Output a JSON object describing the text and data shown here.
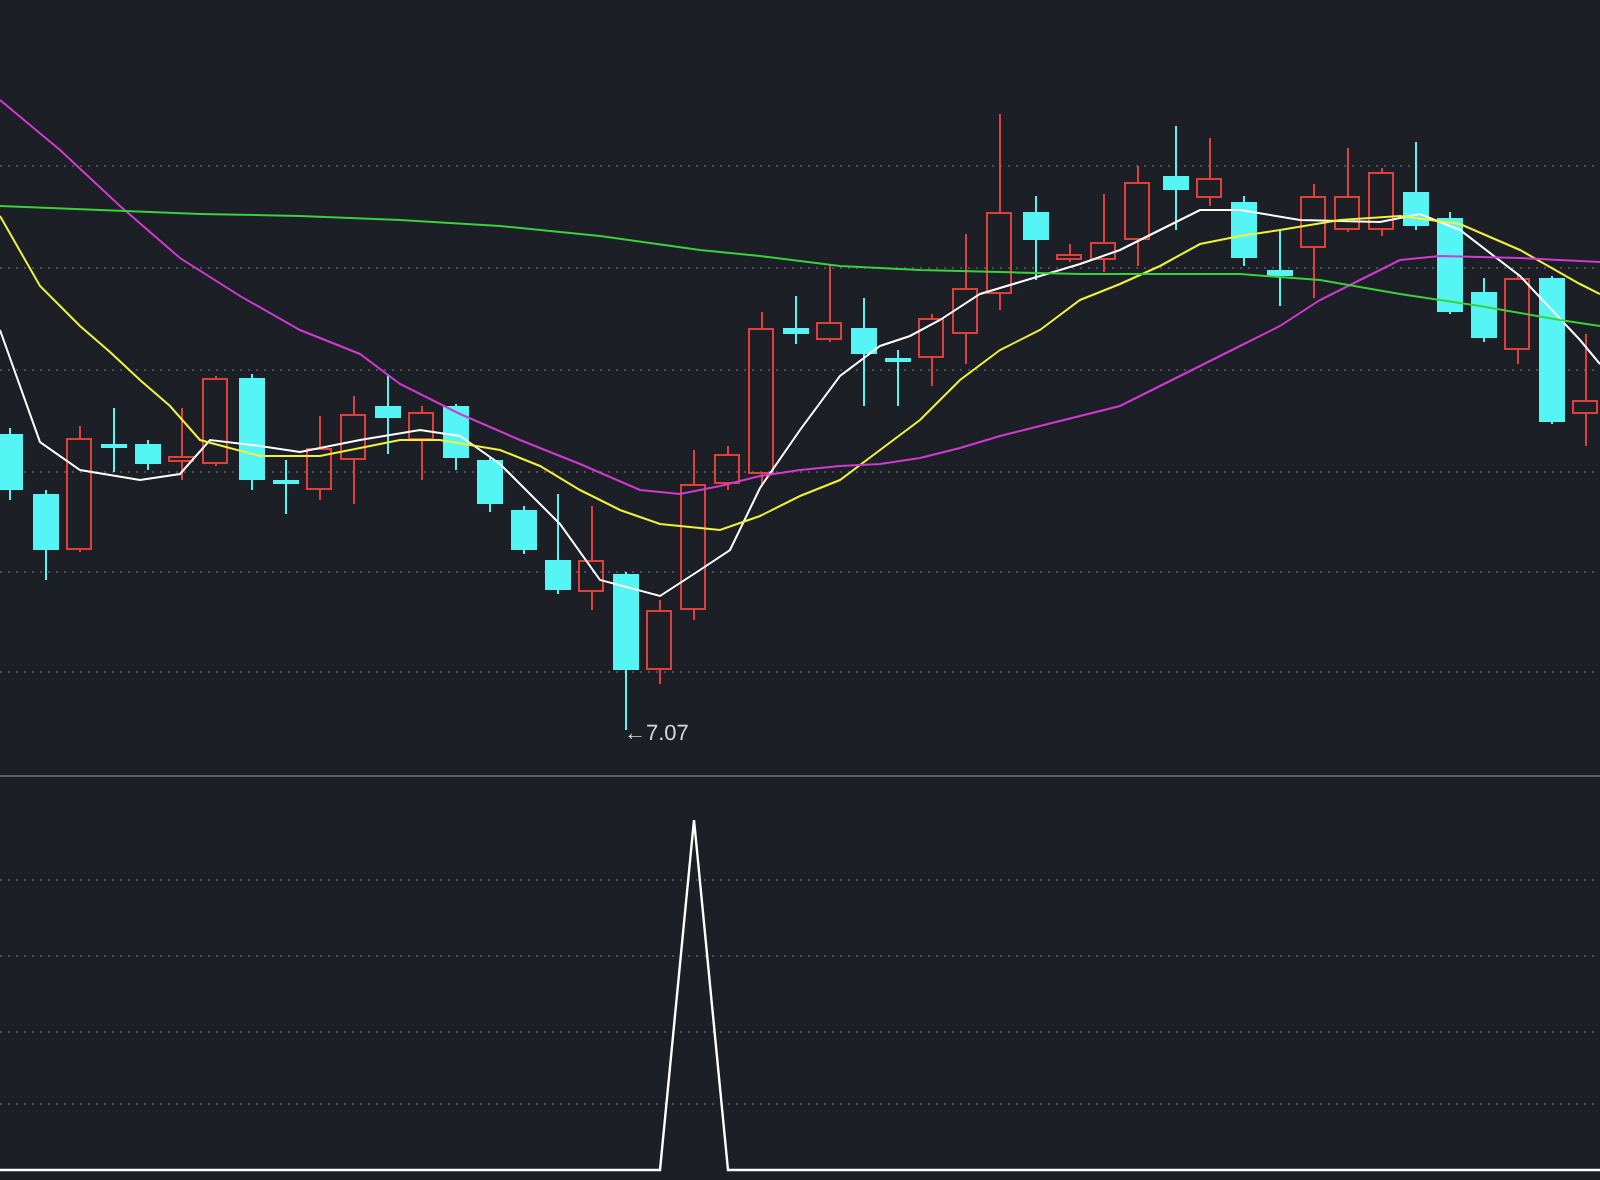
{
  "price_panel": {
    "low_label": "←7.07"
  }
}
